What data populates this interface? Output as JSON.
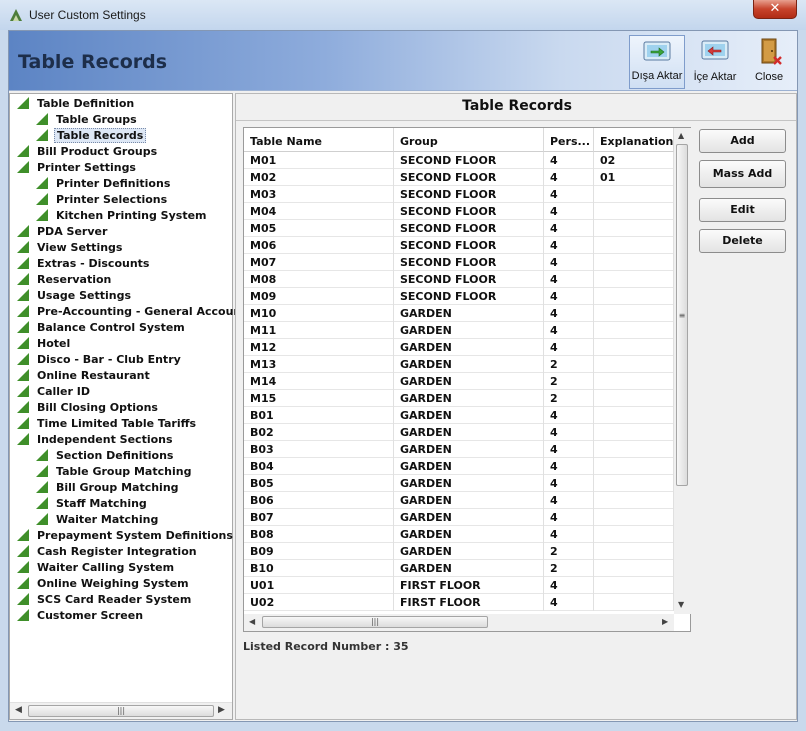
{
  "window": {
    "title": "User Custom Settings",
    "close_glyph": "✕"
  },
  "header": {
    "title": "Table Records",
    "toolbar": [
      {
        "label": "Dışa Aktar",
        "icon": "export-icon"
      },
      {
        "label": "İçe Aktar",
        "icon": "import-icon"
      },
      {
        "label": "Close",
        "icon": "close-door-icon"
      }
    ]
  },
  "tree": {
    "items": [
      {
        "label": "Table Definition",
        "level": 0
      },
      {
        "label": "Table Groups",
        "level": 1
      },
      {
        "label": "Table Records",
        "level": 1,
        "selected": true
      },
      {
        "label": "Bill Product Groups",
        "level": 0
      },
      {
        "label": "Printer Settings",
        "level": 0
      },
      {
        "label": "Printer Definitions",
        "level": 1
      },
      {
        "label": "Printer Selections",
        "level": 1
      },
      {
        "label": "Kitchen Printing System",
        "level": 1
      },
      {
        "label": "PDA Server",
        "level": 0
      },
      {
        "label": "View Settings",
        "level": 0
      },
      {
        "label": "Extras - Discounts",
        "level": 0
      },
      {
        "label": "Reservation",
        "level": 0
      },
      {
        "label": "Usage Settings",
        "level": 0
      },
      {
        "label": "Pre-Accounting - General Accounting",
        "level": 0
      },
      {
        "label": "Balance Control System",
        "level": 0
      },
      {
        "label": "Hotel",
        "level": 0
      },
      {
        "label": "Disco - Bar - Club Entry",
        "level": 0
      },
      {
        "label": "Online Restaurant",
        "level": 0
      },
      {
        "label": "Caller ID",
        "level": 0
      },
      {
        "label": "Bill Closing Options",
        "level": 0
      },
      {
        "label": "Time Limited Table Tariffs",
        "level": 0
      },
      {
        "label": "Independent Sections",
        "level": 0
      },
      {
        "label": "Section Definitions",
        "level": 1
      },
      {
        "label": "Table Group Matching",
        "level": 1
      },
      {
        "label": "Bill Group Matching",
        "level": 1
      },
      {
        "label": "Staff Matching",
        "level": 1
      },
      {
        "label": "Waiter Matching",
        "level": 1
      },
      {
        "label": "Prepayment System Definitions",
        "level": 0
      },
      {
        "label": "Cash Register Integration",
        "level": 0
      },
      {
        "label": "Waiter Calling System",
        "level": 0
      },
      {
        "label": "Online Weighing System",
        "level": 0
      },
      {
        "label": "SCS Card Reader System",
        "level": 0
      },
      {
        "label": "Customer Screen",
        "level": 0
      }
    ]
  },
  "panel": {
    "title": "Table Records",
    "columns": [
      "Table Name",
      "Group",
      "Pers...",
      "Explanation"
    ],
    "rows": [
      [
        "M01",
        "SECOND FLOOR",
        "4",
        "02"
      ],
      [
        "M02",
        "SECOND FLOOR",
        "4",
        "01"
      ],
      [
        "M03",
        "SECOND FLOOR",
        "4",
        ""
      ],
      [
        "M04",
        "SECOND FLOOR",
        "4",
        ""
      ],
      [
        "M05",
        "SECOND FLOOR",
        "4",
        ""
      ],
      [
        "M06",
        "SECOND FLOOR",
        "4",
        ""
      ],
      [
        "M07",
        "SECOND FLOOR",
        "4",
        ""
      ],
      [
        "M08",
        "SECOND FLOOR",
        "4",
        ""
      ],
      [
        "M09",
        "SECOND FLOOR",
        "4",
        ""
      ],
      [
        "M10",
        "GARDEN",
        "4",
        ""
      ],
      [
        "M11",
        "GARDEN",
        "4",
        ""
      ],
      [
        "M12",
        "GARDEN",
        "4",
        ""
      ],
      [
        "M13",
        "GARDEN",
        "2",
        ""
      ],
      [
        "M14",
        "GARDEN",
        "2",
        ""
      ],
      [
        "M15",
        "GARDEN",
        "2",
        ""
      ],
      [
        "B01",
        "GARDEN",
        "4",
        ""
      ],
      [
        "B02",
        "GARDEN",
        "4",
        ""
      ],
      [
        "B03",
        "GARDEN",
        "4",
        ""
      ],
      [
        "B04",
        "GARDEN",
        "4",
        ""
      ],
      [
        "B05",
        "GARDEN",
        "4",
        ""
      ],
      [
        "B06",
        "GARDEN",
        "4",
        ""
      ],
      [
        "B07",
        "GARDEN",
        "4",
        ""
      ],
      [
        "B08",
        "GARDEN",
        "4",
        ""
      ],
      [
        "B09",
        "GARDEN",
        "2",
        ""
      ],
      [
        "B10",
        "GARDEN",
        "2",
        ""
      ],
      [
        "U01",
        "FIRST FLOOR",
        "4",
        ""
      ],
      [
        "U02",
        "FIRST FLOOR",
        "4",
        ""
      ]
    ],
    "buttons": {
      "add": "Add",
      "mass_add": "Mass Add",
      "edit": "Edit",
      "delete": "Delete"
    },
    "listed_record": "Listed Record Number : 35"
  },
  "colors": {
    "accent": "#5c84c4",
    "tree_icon": "#3f8f2a",
    "close": "#c7432b"
  }
}
